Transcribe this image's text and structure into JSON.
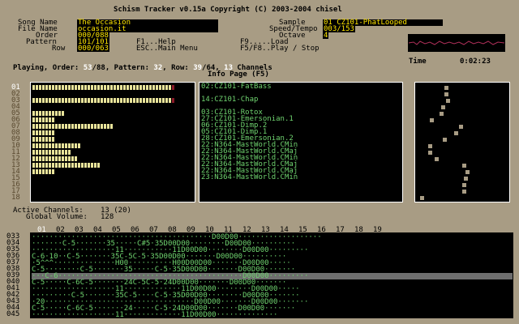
{
  "title": "Schism Tracker v0.15a Copyright (C) 2003-2004 chisel",
  "song": {
    "song_name_label": "Song Name",
    "song_name": "The Occasion",
    "file_name_label": "File Name",
    "file_name": "occasion.it",
    "order_label": "Order",
    "order": "000/088",
    "pattern_label": "Pattern",
    "pattern": "101/101",
    "row_label": "Row",
    "row": "000/063"
  },
  "keys": {
    "f1": "F1...Help",
    "esc": "ESC..Main Menu",
    "f9": "F9.....Load",
    "f5f8": "F5/F8..Play / Stop"
  },
  "sample": {
    "sample_label": "Sample",
    "sample": "01 CZ101-PhatLooped",
    "speed_label": "Speed/Tempo",
    "speed": "003/153",
    "octave_label": "Octave",
    "octave": "4"
  },
  "status": {
    "playing": "Playing, Order: ",
    "order_cur": "53",
    "order_total": "/88",
    "pattern_label": ", Pattern: ",
    "pattern_cur": "32",
    "row_label": ", Row: ",
    "row_cur": "39",
    "row_total": "/64",
    "comma": ", ",
    "channels": "13",
    "channels_label": " Channels",
    "time_label": "Time",
    "time": "0:02:23"
  },
  "info_page_title": "Info Page (F5)",
  "channel_numbers": [
    "01",
    "02",
    "03",
    "04",
    "05",
    "06",
    "07",
    "08",
    "09",
    "10",
    "11",
    "12",
    "13",
    "14",
    "15",
    "16",
    "17",
    "18"
  ],
  "volume_levels": [
    0.95,
    0,
    0.95,
    0,
    0.21,
    0.15,
    0.54,
    0.15,
    0.15,
    0.33,
    0.25,
    0.3,
    0.45,
    0.15,
    0,
    0,
    0,
    0
  ],
  "sample_list": [
    "02:CZ101-FatBass",
    "",
    "14:CZ101-Chap",
    "",
    "03:CZ101-Rotox",
    "27:CZ101-Emersonian.1",
    "06:CZ101-Dimp.2",
    "05:CZ101-Dimp.1",
    "28:CZ101-Emersonian.2",
    "22:N364-MastWorld.CMin",
    "22:N364-MastWorld.CMaj",
    "22:N364-MastWorld.CMin",
    "22:N364-MastWorld.CMaj",
    "22:N364-MastWorld.CMaj",
    "23:N364-MastWorld.CMin"
  ],
  "active_channels_label": "Active Channels:",
  "active_channels": "13 (20)",
  "global_volume_label": "Global Volume:",
  "global_volume": "128",
  "pattern_headers": [
    "01",
    "02",
    "03",
    "04",
    "05",
    "06",
    "07",
    "08",
    "09",
    "10",
    "11",
    "12",
    "13",
    "14",
    "15",
    "16",
    "17",
    "18",
    "19"
  ],
  "pattern_rows": [
    {
      "num": "033",
      "text": "·········································D00D00···················"
    },
    {
      "num": "034",
      "text": "·······C-5·······35·····C#5·35D00D00········D00D00··········"
    },
    {
      "num": "035",
      "text": "···················11···········11D00D00········D00D00·········"
    },
    {
      "num": "036",
      "text": "C-6·10··C-5·······35C-5C-5·35D00D00·······D00D00··········"
    },
    {
      "num": "037",
      "text": "·5^^^··············H00··········H00D00D00·······D00D00·····"
    },
    {
      "num": "038",
      "text": "C-5········C-5·······35·····C-5·35D00D00·······D00D00·······"
    },
    {
      "num": "039",
      "text": "···C-6··········································D00D00·········"
    },
    {
      "num": "040",
      "text": "C-5·····C-6C-5·······24C-5C-5·24D00D00·······D00D00·······"
    },
    {
      "num": "041",
      "text": "···················11·············11D00D00········D00D00·····"
    },
    {
      "num": "042",
      "text": "·········C-5·······35C-5····C-5·35D00D00········D00D00·······"
    },
    {
      "num": "043",
      "text": "·20··································D00D00·······D00D00·······"
    },
    {
      "num": "044",
      "text": "C-5·····C-6C-5·······24·····C-5·24D00D00·······D00D00·······"
    },
    {
      "num": "045",
      "text": "···················11·············11D00D00··············"
    }
  ],
  "colors": {
    "background": "#a89c84",
    "panel": "#000000",
    "value_text": "#ffe600",
    "sample_text": "#6fd36f",
    "volume_bar": "#e8e39a",
    "volume_peak": "#8a1a2a",
    "highlight_row": "#6e6e6e"
  }
}
